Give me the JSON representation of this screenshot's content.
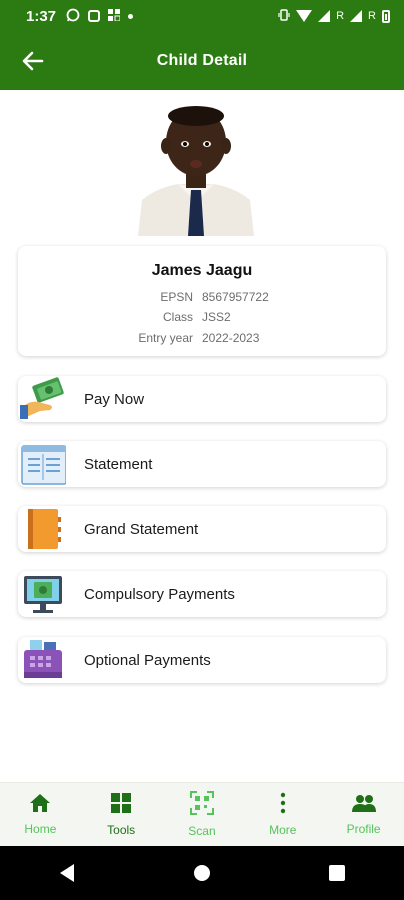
{
  "status_bar": {
    "time": "1:37",
    "network_labels": [
      "R",
      "R"
    ]
  },
  "app_bar": {
    "title": "Child Detail"
  },
  "child": {
    "name": "James Jaagu",
    "fields": [
      {
        "label": "EPSN",
        "value": "8567957722"
      },
      {
        "label": "Class",
        "value": "JSS2"
      },
      {
        "label": "Entry year",
        "value": "2022-2023"
      }
    ]
  },
  "menu": [
    {
      "label": "Pay Now",
      "icon": "money-hand-icon"
    },
    {
      "label": "Statement",
      "icon": "statement-icon"
    },
    {
      "label": "Grand Statement",
      "icon": "notebook-icon"
    },
    {
      "label": "Compulsory Payments",
      "icon": "monitor-money-icon"
    },
    {
      "label": "Optional Payments",
      "icon": "cash-register-icon"
    }
  ],
  "bottom_nav": [
    {
      "label": "Home",
      "icon": "home-icon"
    },
    {
      "label": "Tools",
      "icon": "tools-grid-icon"
    },
    {
      "label": "Scan",
      "icon": "qr-scan-icon"
    },
    {
      "label": "More",
      "icon": "more-vertical-icon"
    },
    {
      "label": "Profile",
      "icon": "people-icon"
    }
  ],
  "colors": {
    "primary": "#2c7a12",
    "nav_accent": "#56c45b",
    "nav_dark": "#1f6f18"
  }
}
